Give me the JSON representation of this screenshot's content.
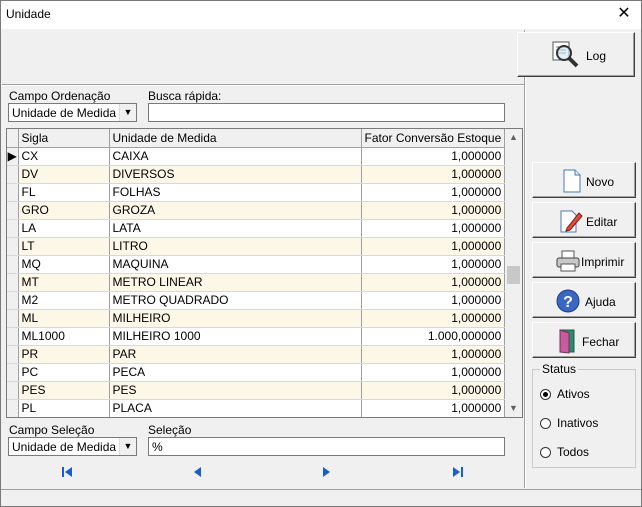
{
  "window": {
    "title": "Unidade",
    "close_label": "✕"
  },
  "buttons": {
    "log": "Log",
    "novo": "Novo",
    "editar": "Editar",
    "imprimir": "Imprimir",
    "ajuda": "Ajuda",
    "fechar": "Fechar"
  },
  "ordenacao": {
    "label": "Campo Ordenação",
    "value": "Unidade de Medida"
  },
  "busca": {
    "label": "Busca rápida:",
    "value": ""
  },
  "grid": {
    "columns": [
      "Sigla",
      "Unidade de Medida",
      "Fator Conversão Estoque"
    ],
    "rows": [
      [
        "CX",
        "CAIXA",
        "1,000000"
      ],
      [
        "DV",
        "DIVERSOS",
        "1,000000"
      ],
      [
        "FL",
        "FOLHAS",
        "1,000000"
      ],
      [
        "GRO",
        "GROZA",
        "1,000000"
      ],
      [
        "LA",
        "LATA",
        "1,000000"
      ],
      [
        "LT",
        "LITRO",
        "1,000000"
      ],
      [
        "MQ",
        "MAQUINA",
        "1,000000"
      ],
      [
        "MT",
        "METRO LINEAR",
        "1,000000"
      ],
      [
        "M2",
        "METRO QUADRADO",
        "1,000000"
      ],
      [
        "ML",
        "MILHEIRO",
        "1,000000"
      ],
      [
        "ML1000",
        "MILHEIRO 1000",
        "1.000,000000"
      ],
      [
        "PR",
        "PAR",
        "1,000000"
      ],
      [
        "PC",
        "PECA",
        "1,000000"
      ],
      [
        "PES",
        "PES",
        "1,000000"
      ],
      [
        "PL",
        "PLACA",
        "1,000000"
      ]
    ],
    "current_row_marker": "▶"
  },
  "selecao_campo": {
    "label": "Campo Seleção",
    "value": "Unidade de Medida"
  },
  "selecao": {
    "label": "Seleção",
    "value": "%"
  },
  "status": {
    "label": "Status",
    "options": [
      "Ativos",
      "Inativos",
      "Todos"
    ],
    "selected": "Ativos"
  },
  "icons": {
    "nav_first": "first-record-icon",
    "nav_prev": "previous-record-icon",
    "nav_next": "next-record-icon",
    "nav_last": "last-record-icon"
  },
  "colors": {
    "nav_arrow": "#1a5fc8",
    "row_alt": "#fdf7e8"
  }
}
